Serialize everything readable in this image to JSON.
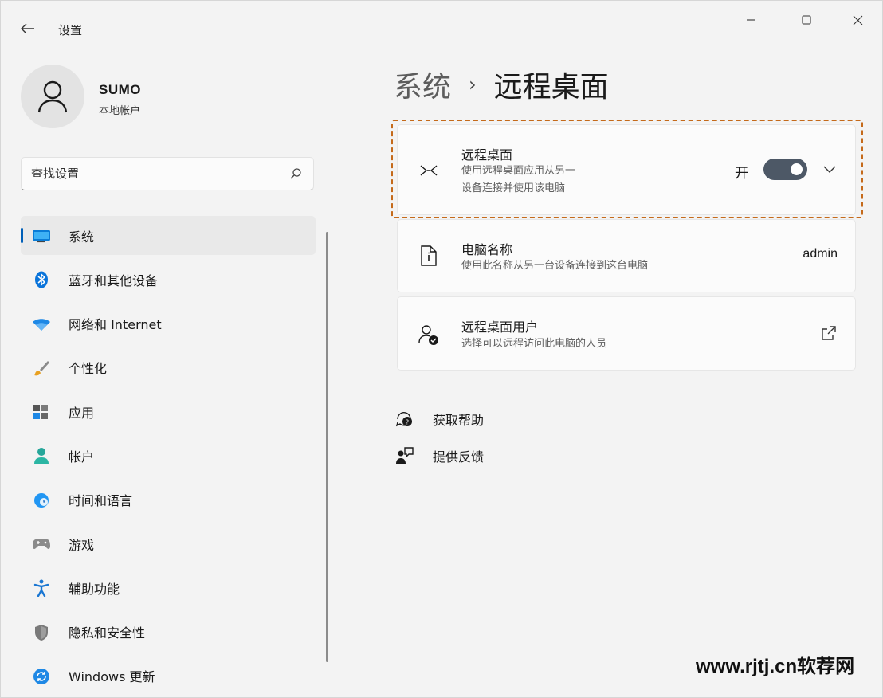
{
  "window": {
    "app_title": "设置",
    "back_icon": "arrow-left-icon",
    "controls": [
      "minimize-icon",
      "maximize-icon",
      "close-icon"
    ]
  },
  "profile": {
    "name": "SUMO",
    "account_type": "本地帐户"
  },
  "search": {
    "placeholder": "查找设置"
  },
  "sidebar": {
    "items": [
      {
        "label": "系统",
        "icon": "monitor-icon",
        "active": true
      },
      {
        "label": "蓝牙和其他设备",
        "icon": "bluetooth-icon"
      },
      {
        "label": "网络和 Internet",
        "icon": "wifi-icon"
      },
      {
        "label": "个性化",
        "icon": "brush-icon"
      },
      {
        "label": "应用",
        "icon": "apps-icon"
      },
      {
        "label": "帐户",
        "icon": "person-icon"
      },
      {
        "label": "时间和语言",
        "icon": "globe-clock-icon"
      },
      {
        "label": "游戏",
        "icon": "gamepad-icon"
      },
      {
        "label": "辅助功能",
        "icon": "accessibility-icon"
      },
      {
        "label": "隐私和安全性",
        "icon": "shield-icon"
      },
      {
        "label": "Windows 更新",
        "icon": "update-icon"
      }
    ]
  },
  "breadcrumb": {
    "parent": "系统",
    "separator": "›",
    "current": "远程桌面"
  },
  "cards": {
    "remote_desktop": {
      "title": "远程桌面",
      "desc_line1": "使用远程桌面应用从另一",
      "desc_line2": "设备连接并使用该电脑",
      "toggle_label": "开",
      "toggle_on": true
    },
    "pc_name": {
      "title": "电脑名称",
      "desc": "使用此名称从另一台设备连接到这台电脑",
      "value": "admin"
    },
    "rd_users": {
      "title": "远程桌面用户",
      "desc": "选择可以远程访问此电脑的人员"
    }
  },
  "links": {
    "help": "获取帮助",
    "feedback": "提供反馈"
  },
  "watermark": "www.rjtj.cn软荐网",
  "colors": {
    "accent": "#005fb8",
    "toggle_on": "#4d5866",
    "highlight_border": "#c56a1a"
  }
}
